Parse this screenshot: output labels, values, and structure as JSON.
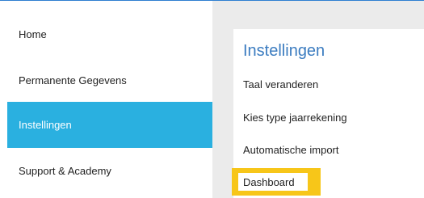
{
  "sidebar": {
    "items": [
      {
        "label": "Home"
      },
      {
        "label": "Permanente Gegevens"
      },
      {
        "label": "Instellingen",
        "active": true
      },
      {
        "label": "Support & Academy"
      }
    ]
  },
  "settings": {
    "title": "Instellingen",
    "links": [
      {
        "label": "Taal veranderen"
      },
      {
        "label": "Kies type jaarrekening"
      },
      {
        "label": "Automatische import"
      },
      {
        "label": "Dashboard",
        "highlighted": true
      }
    ]
  },
  "colors": {
    "accent": "#2ab0e0",
    "title": "#3b7cc0",
    "highlight": "#f7c619",
    "background": "#ebebeb"
  }
}
